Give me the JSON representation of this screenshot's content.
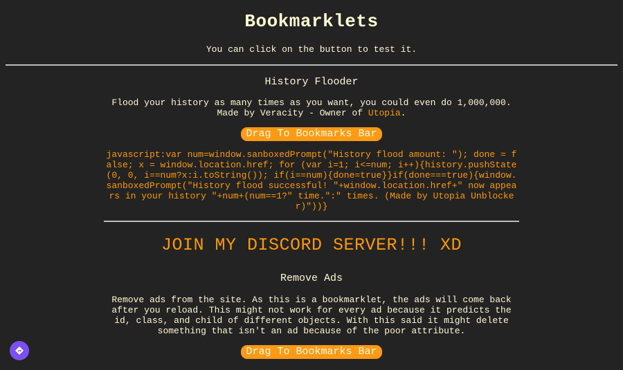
{
  "header": {
    "title": "Bookmarklets",
    "subtitle": "You can click on the button to test it."
  },
  "history_flooder": {
    "title": "History Flooder",
    "description_line1": "Flood your history as many times as you want, you could even do 1,000,000.",
    "description_prefix": "Made by Veracity - Owner of ",
    "description_link": "Utopia",
    "description_suffix": ".",
    "button_label": "Drag To Bookmarks Bar",
    "code": "javascript:var num=window.sanboxedPrompt(\"History flood amount: \"); done = false; x = window.location.href; for (var i=1; i<=num; i++){history.pushState(0, 0, i==num?x:i.toString()); if(i==num){done=true}}if(done===true){window.sanboxedPrompt(\"History flood successful! \"+window.location.href+\" now appears in your history \"+num+(num==1?\" time.\":\" times. (Made by Utopia Unblocker)\"))}"
  },
  "discord": {
    "label": "JOIN MY DISCORD SERVER!!! XD"
  },
  "remove_ads": {
    "title": "Remove Ads",
    "description": "Remove ads from the site. As this is a bookmarklet, the ads will come back after you reload. This might not work for every ad because it predicts the id, class, and child of different objects. With this said it might delete something that isn't an ad because of the poor attribute.",
    "button_label": "Drag To Bookmarks Bar"
  },
  "fab": {
    "icon": "diamond-arrow-icon"
  },
  "colors": {
    "background": "#232323",
    "accent": "#ff9900",
    "button": "#ff9a14",
    "fab": "#7b4ff0"
  }
}
